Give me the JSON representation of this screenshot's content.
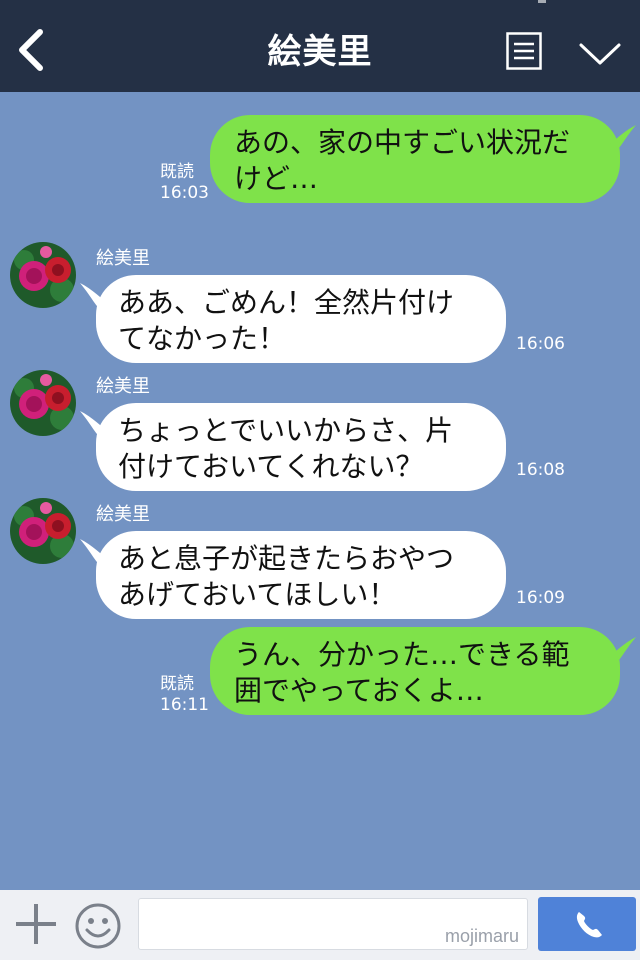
{
  "header": {
    "title": "絵美里",
    "back_icon": "chevron-left-icon",
    "menu_icon": "menu-list-icon",
    "expand_icon": "chevron-down-icon"
  },
  "messages": [
    {
      "side": "out",
      "text_lines": [
        "あの、家の中すごい状況だ",
        "けど…"
      ],
      "read": "既読",
      "time": "16:03"
    },
    {
      "side": "in",
      "sender": "絵美里",
      "text_lines": [
        "ああ、ごめん！全然片付け",
        "てなかった！"
      ],
      "time": "16:06"
    },
    {
      "side": "in",
      "sender": "絵美里",
      "text_lines": [
        "ちょっとでいいからさ、片",
        "付けておいてくれない？"
      ],
      "time": "16:08"
    },
    {
      "side": "in",
      "sender": "絵美里",
      "text_lines": [
        "あと息子が起きたらおやつ",
        "あげておいてほしい！"
      ],
      "time": "16:09"
    },
    {
      "side": "out",
      "text_lines": [
        "うん、分かった…できる範",
        "囲でやっておくよ…"
      ],
      "read": "既読",
      "time": "16:11"
    }
  ],
  "input": {
    "plus_icon": "plus-icon",
    "emoji_icon": "smiley-icon",
    "placeholder": "",
    "watermark": "mojimaru",
    "call_icon": "phone-icon"
  },
  "colors": {
    "header_bg": "#243045",
    "chat_bg": "#7393c3",
    "outgoing_bubble": "#7fe24a",
    "incoming_bubble": "#ffffff",
    "call_button": "#4f82d8"
  }
}
